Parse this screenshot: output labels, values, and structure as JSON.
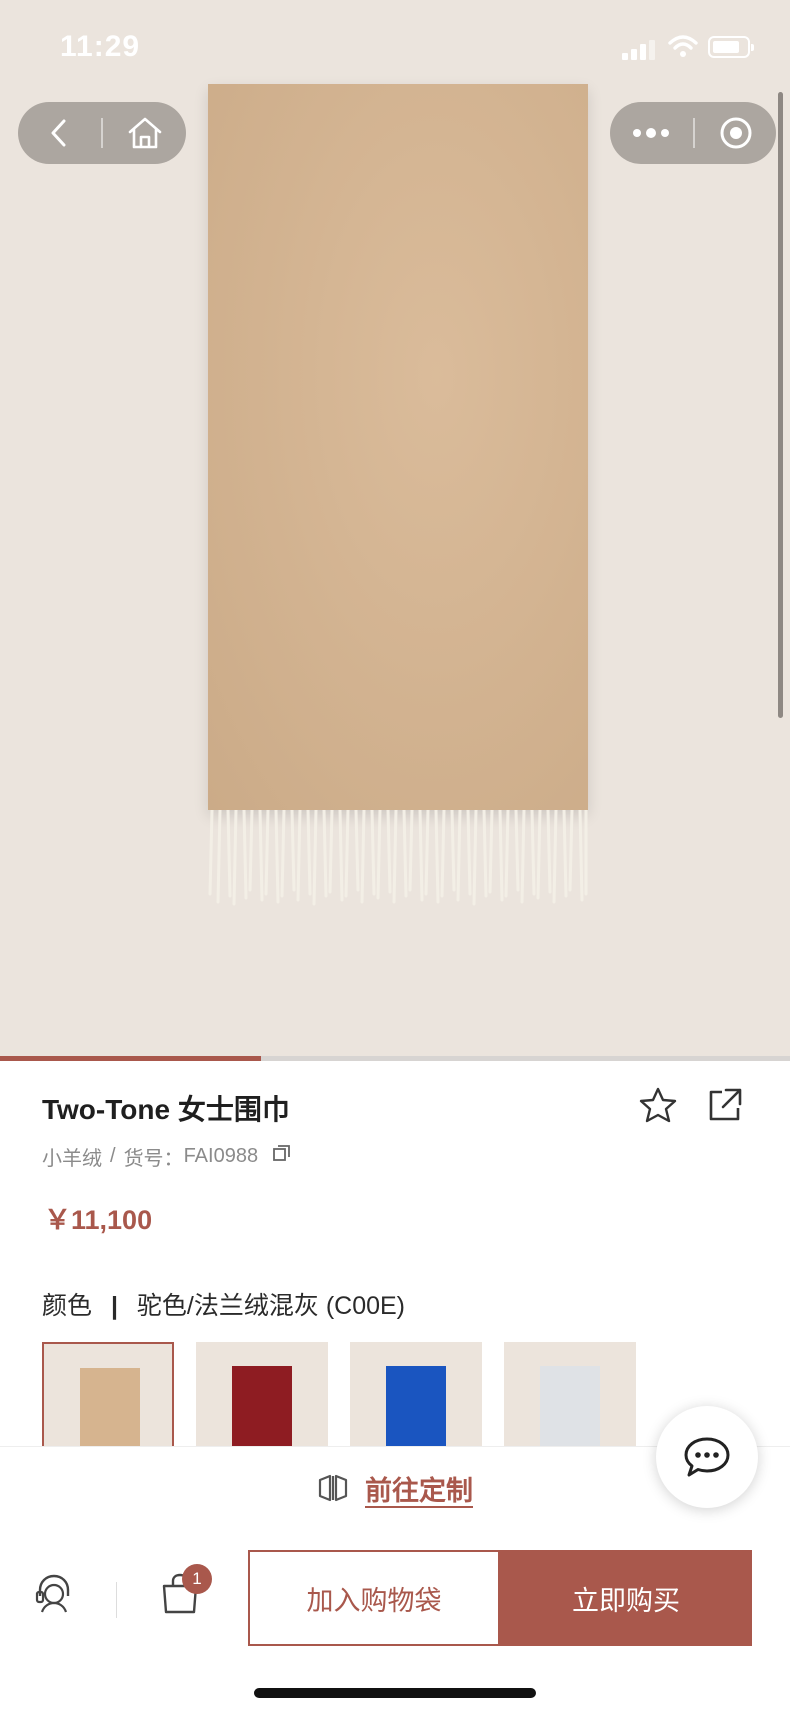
{
  "status_bar": {
    "time": "11:29"
  },
  "product": {
    "title": "Two-Tone 女士围巾",
    "material": "小羊绒",
    "sku_label": "货号：",
    "sku": "FAI0988",
    "price": "￥11,100",
    "color_label": "颜色",
    "color_divider": "|",
    "color_value": "驼色/法兰绒混灰 (C00E)",
    "image_progress": 0.33
  },
  "swatches": [
    {
      "name": "camel",
      "color": "#d6b48f",
      "selected": true
    },
    {
      "name": "burgundy",
      "color": "#8e1c22",
      "selected": false
    },
    {
      "name": "blue",
      "color": "#1a55c0",
      "selected": false
    },
    {
      "name": "light-grey",
      "color": "#dfe2e6",
      "selected": false
    }
  ],
  "customize": {
    "label": "前往定制"
  },
  "bottom_bar": {
    "cart_count": "1",
    "add_to_bag": "加入购物袋",
    "buy_now": "立即购买"
  },
  "icons": [
    "back-icon",
    "home-icon",
    "more-icon",
    "target-icon",
    "star-icon",
    "share-icon",
    "copy-icon",
    "customize-icon",
    "chat-icon",
    "service-icon",
    "bag-icon"
  ],
  "colors": {
    "accent": "#a9584c",
    "hero_bg": "#ebe4dd"
  }
}
